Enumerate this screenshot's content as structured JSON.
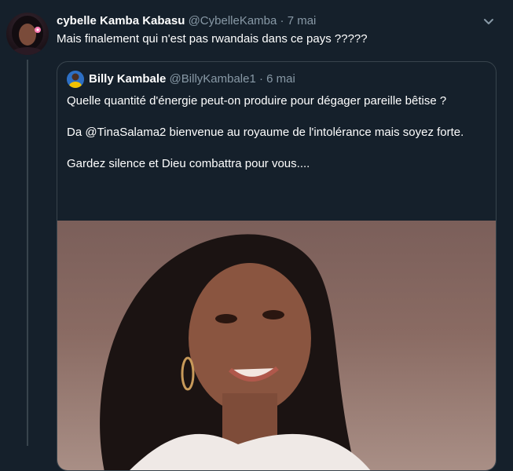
{
  "tweet": {
    "author_name": "cybelle Kamba Kabasu",
    "author_handle": "@CybelleKamba",
    "separator": "·",
    "time": "7 mai",
    "text": "Mais finalement qui n'est pas rwandais dans ce pays ?????",
    "menu_icon": "chevron-down-icon"
  },
  "quote": {
    "author_name": "Billy Kambale",
    "author_handle": "@BillyKambale1",
    "separator": "·",
    "time": "6 mai",
    "paragraphs": [
      "Quelle quantité d'énergie peut-on produire pour dégager pareille bêtise ?",
      "Da @TinaSalama2  bienvenue au royaume de l'intolérance mais soyez forte.",
      "Gardez silence et Dieu combattra pour vous...."
    ]
  },
  "colors": {
    "background": "#15202b",
    "secondary_text": "#8899a6",
    "border": "#38444d"
  }
}
